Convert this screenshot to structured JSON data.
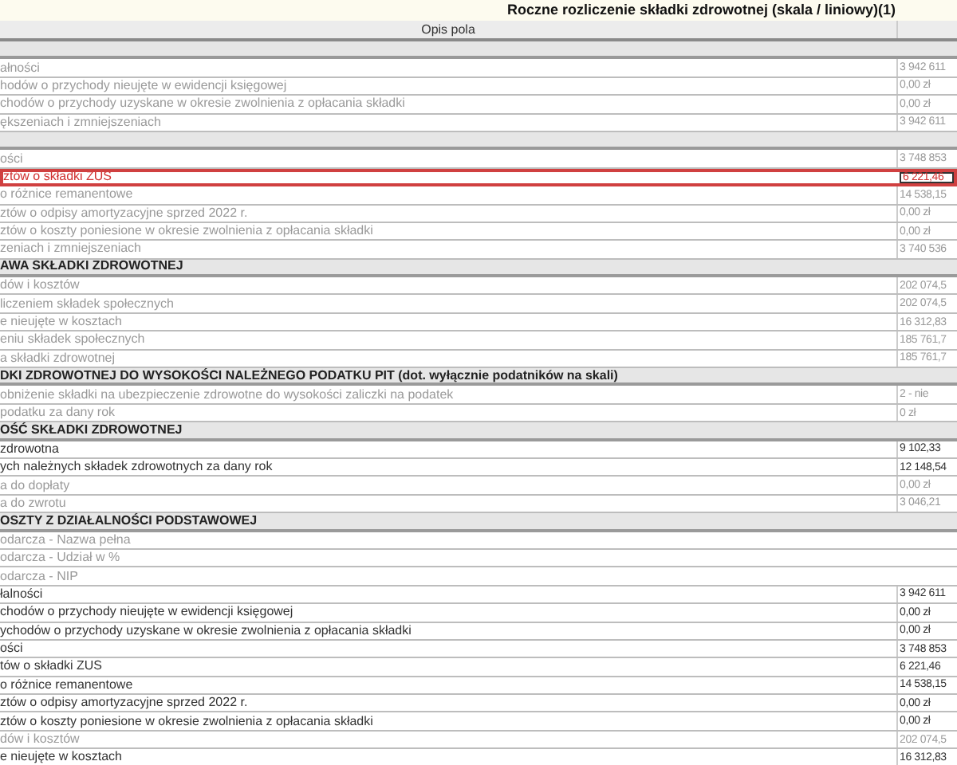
{
  "title": "Roczne rozliczenie składki zdrowotnej (skala / liniowy)(1)",
  "columns": {
    "column_1": "Opis pola"
  },
  "rows": [
    {
      "kind": "section"
    },
    {
      "kind": "field",
      "label": "ałności",
      "value": "3 942 611",
      "muted": true,
      "highlighted": false
    },
    {
      "kind": "field",
      "label": "hodów o przychody nieujęte w ewidencji księgowej",
      "value": "0,00 zł",
      "muted": true,
      "highlighted": false
    },
    {
      "kind": "field",
      "label": "chodów o przychody uzyskane w okresie zwolnienia z opłacania składki",
      "value": "0,00 zł",
      "muted": true,
      "highlighted": false
    },
    {
      "kind": "field",
      "label": "ększeniach i zmniejszeniach",
      "value": "3 942 611",
      "muted": true,
      "highlighted": false
    },
    {
      "kind": "section"
    },
    {
      "kind": "field",
      "label": "ości",
      "value": "3 748 853",
      "muted": true,
      "highlighted": false
    },
    {
      "kind": "field",
      "label": "ztów o składki ZUS",
      "value": "6 221,46",
      "highlighted": true
    },
    {
      "kind": "field",
      "label": "o różnice remanentowe",
      "value": "14 538,15",
      "muted": true,
      "highlighted": false
    },
    {
      "kind": "field",
      "label": "ztów o odpisy amortyzacyjne sprzed 2022 r.",
      "value": "0,00 zł",
      "muted": true,
      "highlighted": false
    },
    {
      "kind": "field",
      "label": "ztów o koszty poniesione w okresie zwolnienia z opłacania składki",
      "value": "0,00 zł",
      "muted": true,
      "highlighted": false
    },
    {
      "kind": "field",
      "label": "zeniach i zmniejszeniach",
      "value": "3 740 536",
      "muted": true,
      "highlighted": false
    },
    {
      "kind": "section",
      "label": "AWA SKŁADKI ZDROWOTNEJ"
    },
    {
      "kind": "field",
      "label": "dów i kosztów",
      "value": "202 074,5",
      "muted": true,
      "highlighted": false
    },
    {
      "kind": "field",
      "label": "liczeniem składek społecznych",
      "value": "202 074,5",
      "muted": true,
      "highlighted": false
    },
    {
      "kind": "field",
      "label": "e nieujęte w kosztach",
      "value": "16 312,83",
      "muted": true,
      "highlighted": false
    },
    {
      "kind": "field",
      "label": "eniu składek społecznych",
      "value": "185 761,7",
      "muted": true,
      "highlighted": false
    },
    {
      "kind": "field",
      "label": "a składki zdrowotnej",
      "value": "185 761,7",
      "muted": true,
      "highlighted": false
    },
    {
      "kind": "section",
      "label": "DKI ZDROWOTNEJ DO WYSOKOŚCI NALEŻNEGO PODATKU PIT (dot. wyłącznie podatników na skali)"
    },
    {
      "kind": "field",
      "label": "obniżenie składki na ubezpieczenie zdrowotne do wysokości zaliczki na podatek",
      "value": "2 - nie",
      "muted": true,
      "highlighted": false
    },
    {
      "kind": "field",
      "label": "podatku za dany rok",
      "value": "0 zł",
      "muted": true,
      "highlighted": false
    },
    {
      "kind": "section",
      "label": "OŚĆ SKŁADKI ZDROWOTNEJ"
    },
    {
      "kind": "field",
      "label": "zdrowotna",
      "value": "9 102,33",
      "muted": false,
      "highlighted": false
    },
    {
      "kind": "field",
      "label": "ych należnych składek zdrowotnych za dany rok",
      "value": "12 148,54",
      "muted": false,
      "highlighted": false
    },
    {
      "kind": "field",
      "label": "a do dopłaty",
      "value": "0,00 zł",
      "muted": true,
      "highlighted": false
    },
    {
      "kind": "field",
      "label": "a do zwrotu",
      "value": "3 046,21",
      "muted": true,
      "highlighted": false
    },
    {
      "kind": "section",
      "label": "OSZTY Z DZIAŁALNOŚCI PODSTAWOWEJ"
    },
    {
      "kind": "field",
      "label": "odarcza - Nazwa pełna",
      "muted": true,
      "highlighted": false
    },
    {
      "kind": "field",
      "label": "odarcza - Udział w %",
      "muted": true,
      "highlighted": false
    },
    {
      "kind": "field",
      "label": "odarcza - NIP",
      "muted": true,
      "highlighted": false
    },
    {
      "kind": "field",
      "label": "łalności",
      "value": "3 942 611",
      "muted": false,
      "highlighted": false
    },
    {
      "kind": "field",
      "label": "chodów o przychody nieujęte w ewidencji księgowej",
      "value": "0,00 zł",
      "muted": false,
      "highlighted": false
    },
    {
      "kind": "field",
      "label": "ychodów o przychody uzyskane w okresie zwolnienia z opłacania składki",
      "value": "0,00 zł",
      "muted": false,
      "highlighted": false
    },
    {
      "kind": "field",
      "label": "ości",
      "value": "3 748 853",
      "muted": false,
      "highlighted": false
    },
    {
      "kind": "field",
      "label": "tów o składki ZUS",
      "value": "6 221,46",
      "muted": false,
      "highlighted": false
    },
    {
      "kind": "field",
      "label": "o różnice remanentowe",
      "value": "14 538,15",
      "muted": false,
      "highlighted": false
    },
    {
      "kind": "field",
      "label": "ztów o odpisy amortyzacyjne sprzed 2022 r.",
      "value": "0,00 zł",
      "muted": false,
      "highlighted": false
    },
    {
      "kind": "field",
      "label": "ztów o koszty poniesione w okresie zwolnienia z opłacania składki",
      "value": "0,00 zł",
      "muted": false,
      "highlighted": false
    },
    {
      "kind": "field",
      "label": "dów i kosztów",
      "value": "202 074,5",
      "muted": true,
      "highlighted": false
    },
    {
      "kind": "field",
      "label": "e nieujęte w kosztach",
      "value": "16 312,83",
      "muted": false,
      "highlighted": false
    }
  ]
}
